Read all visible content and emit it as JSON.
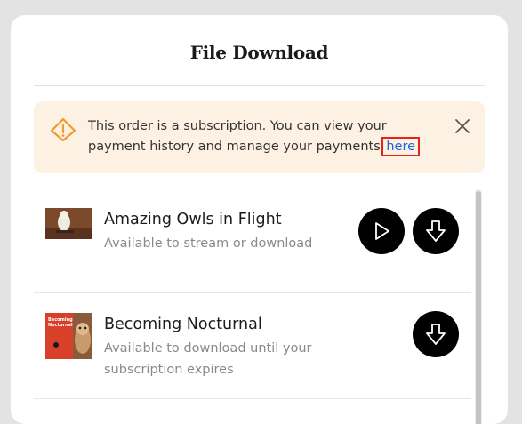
{
  "dialog": {
    "title": "File Download"
  },
  "alert": {
    "icon": "warning-icon",
    "text_before_link": "This order is a subscription. You can view your payment history and manage your payments ",
    "link_label": "here",
    "close_icon": "close-icon",
    "accent_color": "#f39b2b",
    "background_color": "#fdf1e4"
  },
  "items": [
    {
      "title": "Amazing Owls in Flight",
      "subtitle": "Available to stream or download",
      "thumbnail": "snowy owl photo",
      "actions": [
        "play-icon",
        "download-icon"
      ]
    },
    {
      "title": "Becoming Nocturnal",
      "subtitle": "Available to download until your subscription expires",
      "thumbnail": "book cover",
      "cover_title": "Becoming Nocturnal",
      "actions": [
        "download-icon"
      ]
    }
  ],
  "colors": {
    "link": "#1a66d6",
    "highlight": "#e8231a",
    "button": "#000000"
  }
}
